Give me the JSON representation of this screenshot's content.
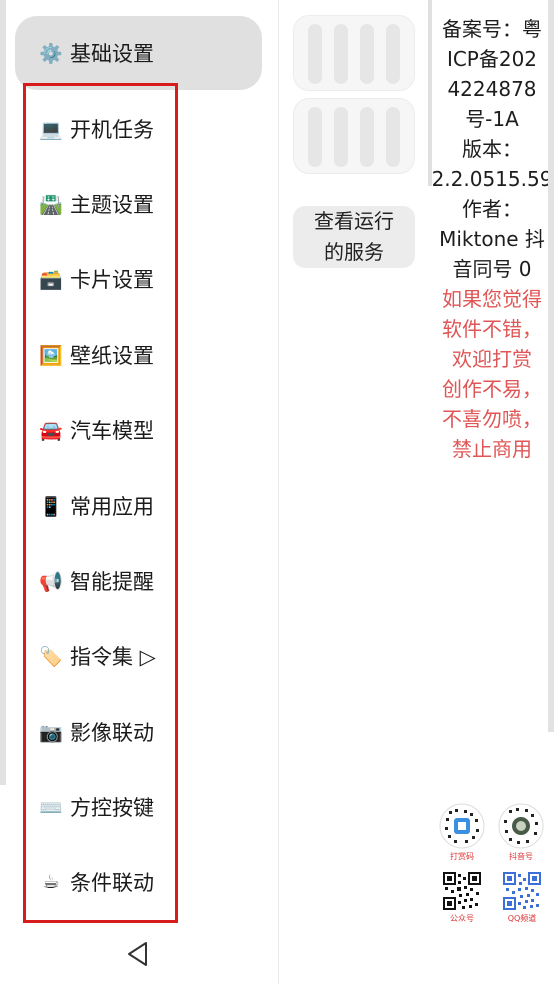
{
  "sidebar": {
    "items": [
      {
        "icon": "⚙️",
        "icon_name": "gear-icon",
        "label": "基础设置"
      },
      {
        "icon": "💻",
        "icon_name": "laptop-icon",
        "label": "开机任务"
      },
      {
        "icon": "🛣️",
        "icon_name": "motorway-icon",
        "label": "主题设置"
      },
      {
        "icon": "🗃️",
        "icon_name": "card-box-icon",
        "label": "卡片设置"
      },
      {
        "icon": "🖼️",
        "icon_name": "picture-icon",
        "label": "壁纸设置"
      },
      {
        "icon": "🚘",
        "icon_name": "car-icon",
        "label": "汽车模型"
      },
      {
        "icon": "📱",
        "icon_name": "phone-icon",
        "label": "常用应用"
      },
      {
        "icon": "📢",
        "icon_name": "megaphone-icon",
        "label": "智能提醒"
      },
      {
        "icon": "🏷️",
        "icon_name": "tag-icon",
        "label": "指令集 ▷"
      },
      {
        "icon": "📷",
        "icon_name": "camera-icon",
        "label": "影像联动"
      },
      {
        "icon": "⌨️",
        "icon_name": "keyboard-icon",
        "label": "方控按键"
      },
      {
        "icon": "☕",
        "icon_name": "coffee-icon",
        "label": "条件联动"
      }
    ],
    "active_index": 0
  },
  "main": {
    "service_button": "查看运行的服务"
  },
  "info": {
    "lines": [
      "备案号：粤",
      "ICP备202",
      "4224878",
      "号-1A",
      "版本：",
      "2.2.0515.59",
      "作者：",
      "Miktone 抖",
      "音同号 0"
    ],
    "plea_lines": [
      "如果您觉得",
      "软件不错，",
      "欢迎打赏",
      "创作不易，",
      "不喜勿喷，",
      "禁止商用"
    ]
  },
  "qr_codes": [
    {
      "caption": "打赏码",
      "icon_name": "reward-qr-icon"
    },
    {
      "caption": "抖音号",
      "icon_name": "douyin-qr-icon"
    },
    {
      "caption": "公众号",
      "icon_name": "wechat-official-qr-icon"
    },
    {
      "caption": "QQ频道",
      "icon_name": "qq-channel-qr-icon"
    }
  ],
  "colors": {
    "highlight": "#d81b1b",
    "plea_text": "#e05555",
    "active_bg": "#e0e0e0"
  }
}
